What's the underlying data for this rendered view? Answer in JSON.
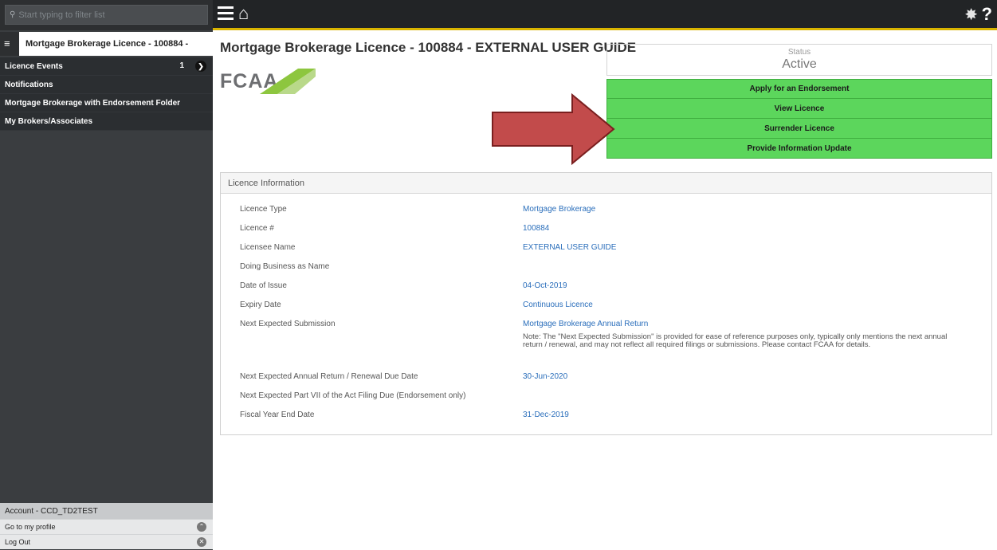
{
  "sidebar": {
    "search_placeholder": "Start typing to filter list",
    "active_item": "Mortgage Brokerage Licence - 100884 -",
    "items": [
      {
        "label": "Licence Events",
        "count": "1"
      },
      {
        "label": "Notifications"
      },
      {
        "label": "Mortgage Brokerage with Endorsement Folder"
      },
      {
        "label": "My Brokers/Associates"
      }
    ],
    "account_label": "Account - CCD_TD2TEST",
    "profile_link": "Go to my profile",
    "logout_link": "Log Out"
  },
  "topbar": {
    "help_symbol": "?"
  },
  "main": {
    "title": "Mortgage Brokerage Licence - 100884 - EXTERNAL USER GUIDE",
    "logo_text": "FCAA",
    "status": {
      "caption": "Status",
      "value": "Active"
    },
    "actions": [
      "Apply for an Endorsement",
      "View Licence",
      "Surrender Licence",
      "Provide Information Update"
    ],
    "licence_info": {
      "heading": "Licence Information",
      "rows": [
        {
          "label": "Licence Type",
          "value": "Mortgage Brokerage"
        },
        {
          "label": "Licence #",
          "value": "100884"
        },
        {
          "label": "Licensee Name",
          "value": "EXTERNAL USER GUIDE"
        },
        {
          "label": "Doing Business as Name",
          "value": ""
        },
        {
          "label": "Date of Issue",
          "value": "04-Oct-2019"
        },
        {
          "label": "Expiry Date",
          "value": "Continuous Licence"
        },
        {
          "label": "Next Expected Submission",
          "value": "Mortgage Brokerage Annual Return",
          "note": "Note: The \"Next Expected Submission\" is provided for ease of reference purposes only, typically only mentions the next annual return / renewal, and may not reflect all required filings or submissions. Please contact FCAA for details."
        },
        {
          "label": "Next Expected Annual Return / Renewal Due Date",
          "value": "30-Jun-2020"
        },
        {
          "label": "Next Expected Part VII of the Act Filing Due (Endorsement only)",
          "value": ""
        },
        {
          "label": "Fiscal Year End Date",
          "value": "31-Dec-2019"
        }
      ]
    }
  },
  "colors": {
    "action_green": "#5cd65c",
    "link_blue": "#2a6ebb",
    "arrow_red": "#c24b4b",
    "topbar_accent": "#d9b400"
  }
}
